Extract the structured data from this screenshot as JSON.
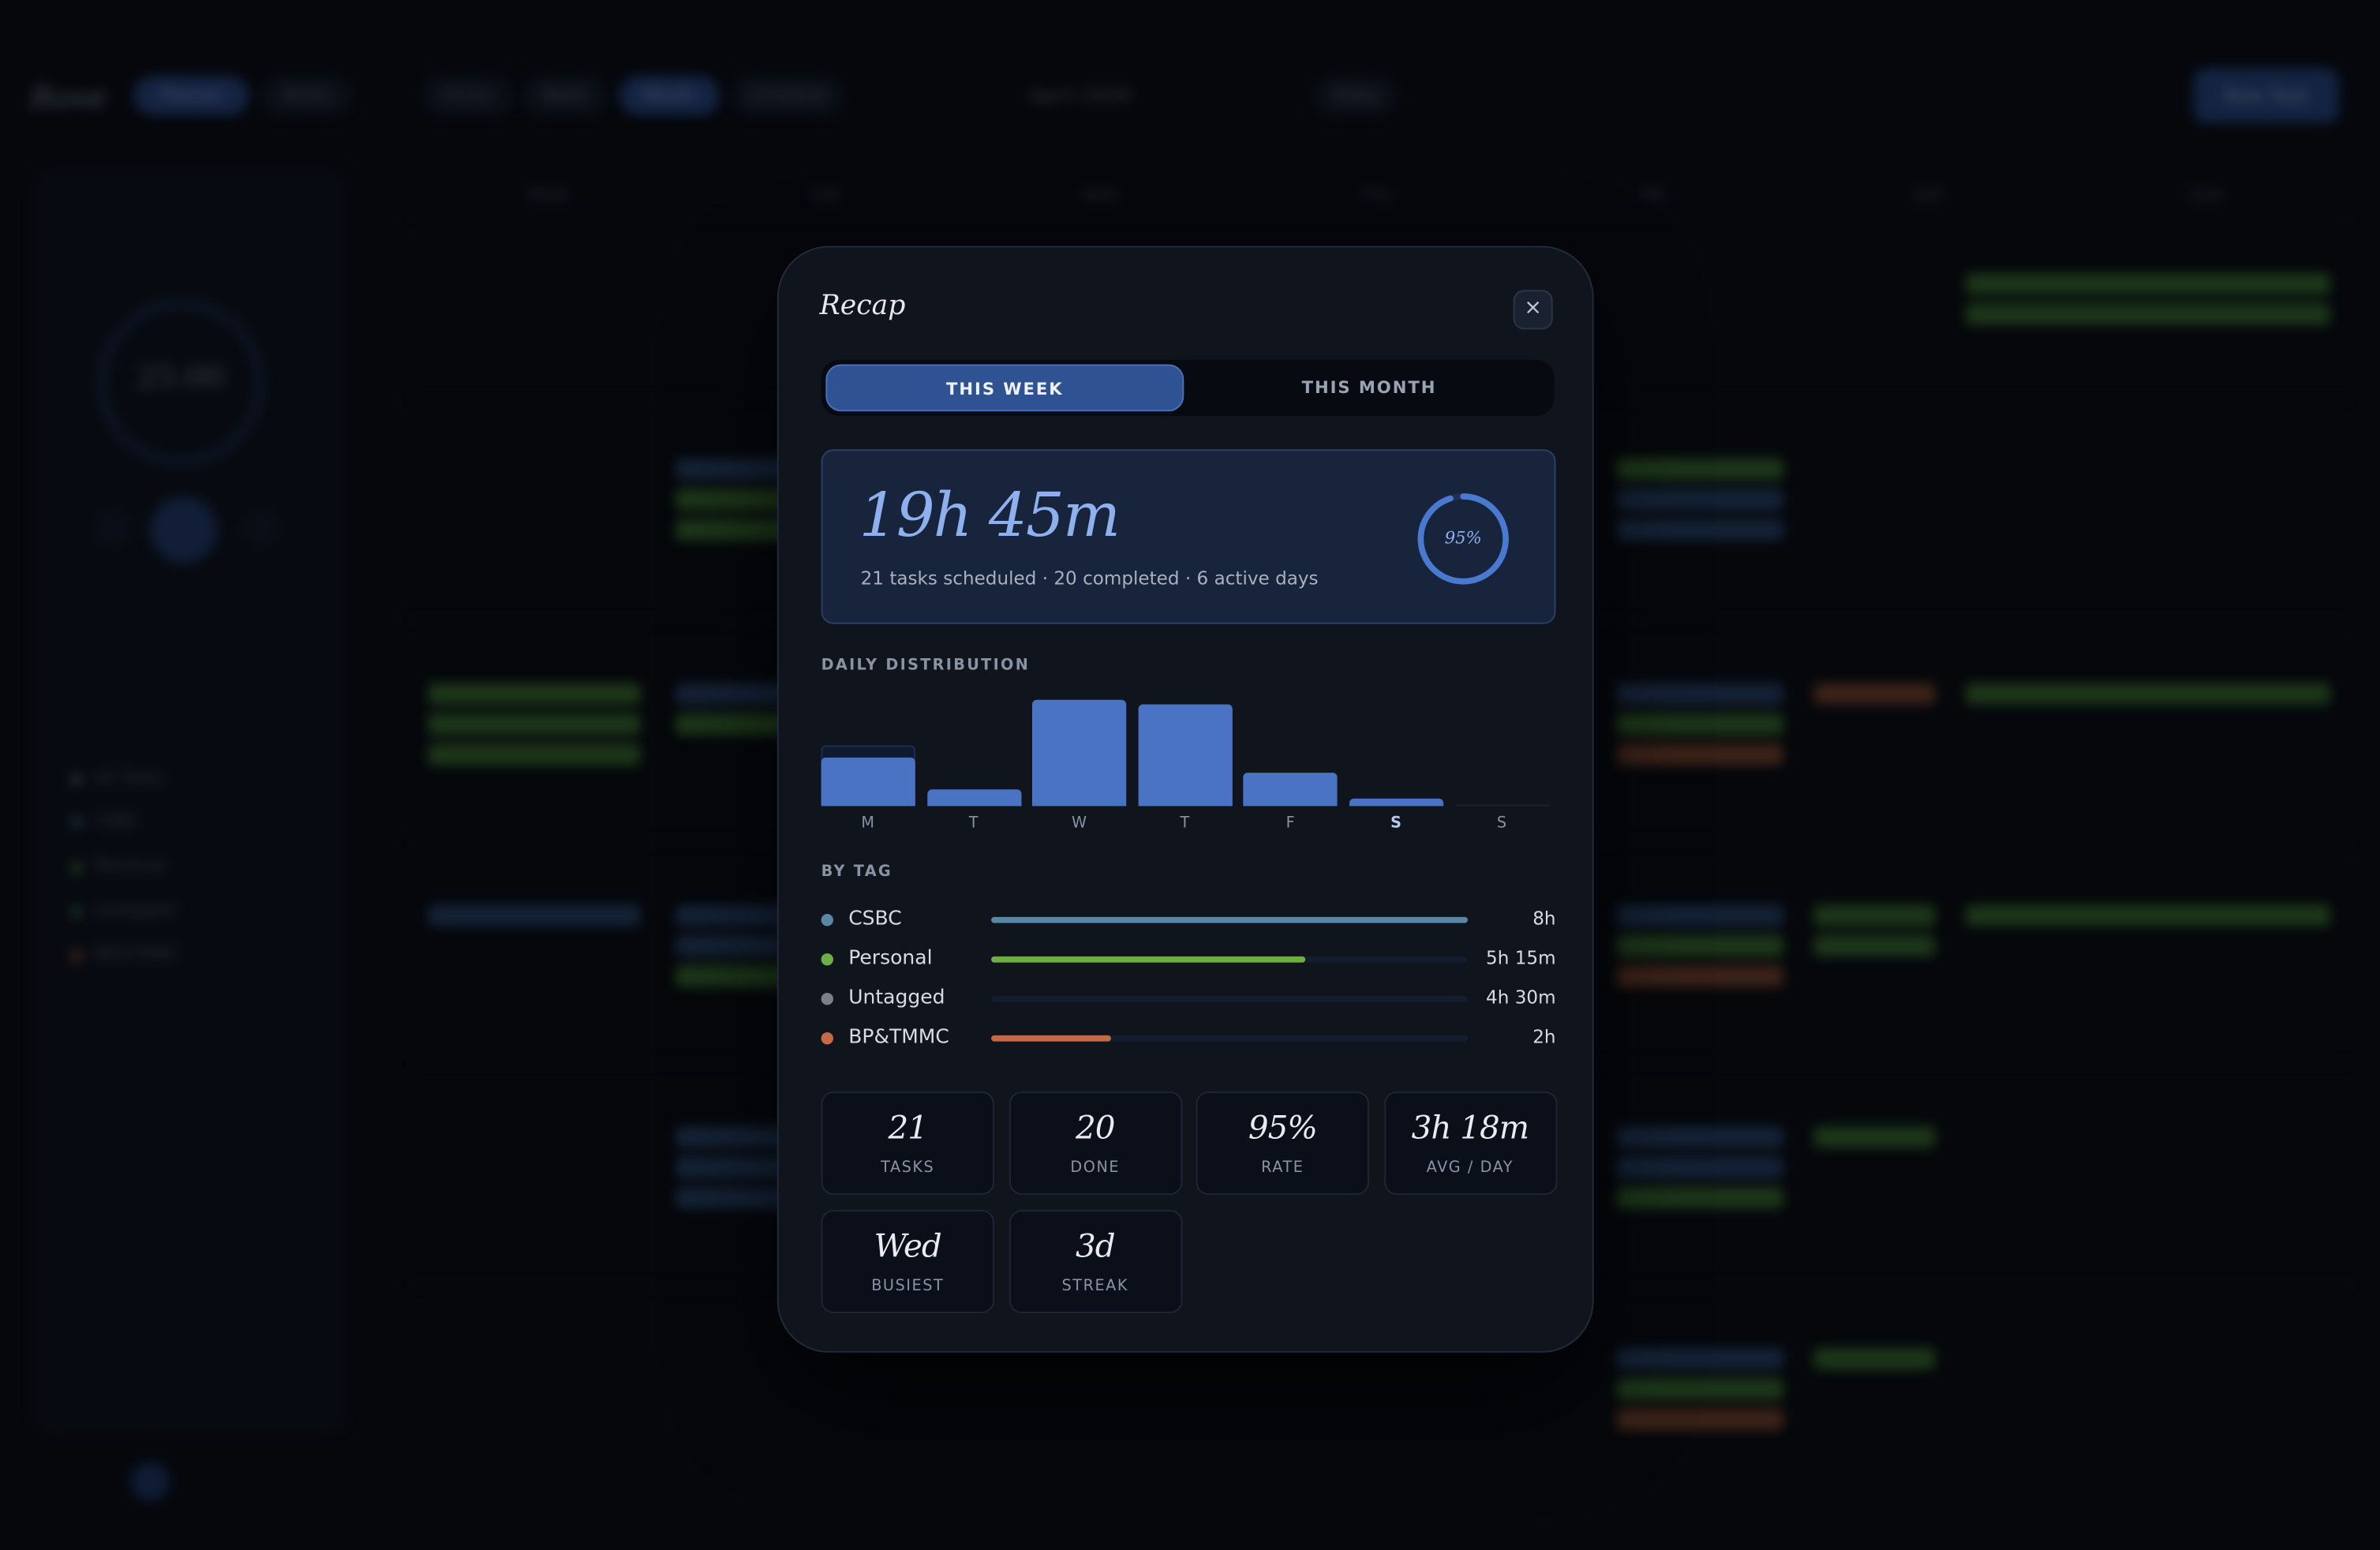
{
  "background": {
    "logo": "Rove",
    "nav_pills": [
      "Planner",
      "Notes"
    ],
    "view_pills": [
      "Focus",
      "Week",
      "Month",
      "Schedule"
    ],
    "month": "April 2026",
    "filter": "Today",
    "new_task": "New Task",
    "timer": "25:00",
    "day_heads": [
      "MON",
      "TUE",
      "WED",
      "THU",
      "FRI",
      "SAT",
      "SUN"
    ],
    "side_tags": [
      "All Tasks",
      "CSBC",
      "Personal",
      "Untagged",
      "BP&TMMC"
    ]
  },
  "modal": {
    "title": "Recap",
    "close_label": "×",
    "tabs": [
      {
        "label": "THIS WEEK",
        "active": true
      },
      {
        "label": "THIS MONTH",
        "active": false
      }
    ],
    "summary": {
      "total": "19h 45m",
      "subtitle": "21 tasks scheduled · 20 completed · 6 active days",
      "completion_label": "95%",
      "completion_fraction": 0.95
    },
    "daily_label": "DAILY DISTRIBUTION",
    "by_tag_label": "BY TAG",
    "tags": [
      {
        "name": "CSBC",
        "value": "8h",
        "fraction": 1.0,
        "color": "#5a86a8",
        "dot": "#5a86a8"
      },
      {
        "name": "Personal",
        "value": "5h 15m",
        "fraction": 0.66,
        "color": "#6fae47",
        "dot": "#6fae47"
      },
      {
        "name": "Untagged",
        "value": "4h 30m",
        "fraction": 0.0,
        "color": "#7a7f88",
        "dot": "#7a7f88"
      },
      {
        "name": "BP&TMMC",
        "value": "2h",
        "fraction": 0.25,
        "color": "#c46a45",
        "dot": "#c46a45"
      }
    ],
    "stats": [
      {
        "num": "21",
        "label": "TASKS"
      },
      {
        "num": "20",
        "label": "DONE"
      },
      {
        "num": "95%",
        "label": "RATE"
      },
      {
        "num": "3h 18m",
        "label": "AVG / DAY"
      },
      {
        "num": "Wed",
        "label": "BUSIEST"
      },
      {
        "num": "3d",
        "label": "STREAK"
      }
    ]
  },
  "chart_data": {
    "type": "bar",
    "title": "DAILY DISTRIBUTION",
    "categories": [
      "M",
      "T",
      "W",
      "T",
      "F",
      "S",
      "S"
    ],
    "values": [
      1.8,
      0.6,
      3.9,
      3.7,
      1.2,
      0.3,
      0
    ],
    "scheduled_overlay": [
      2.2,
      null,
      null,
      null,
      null,
      null,
      null
    ],
    "highlighted_category_index": 5,
    "ylim": [
      0,
      4
    ],
    "accent_color": "#4a73c4"
  }
}
